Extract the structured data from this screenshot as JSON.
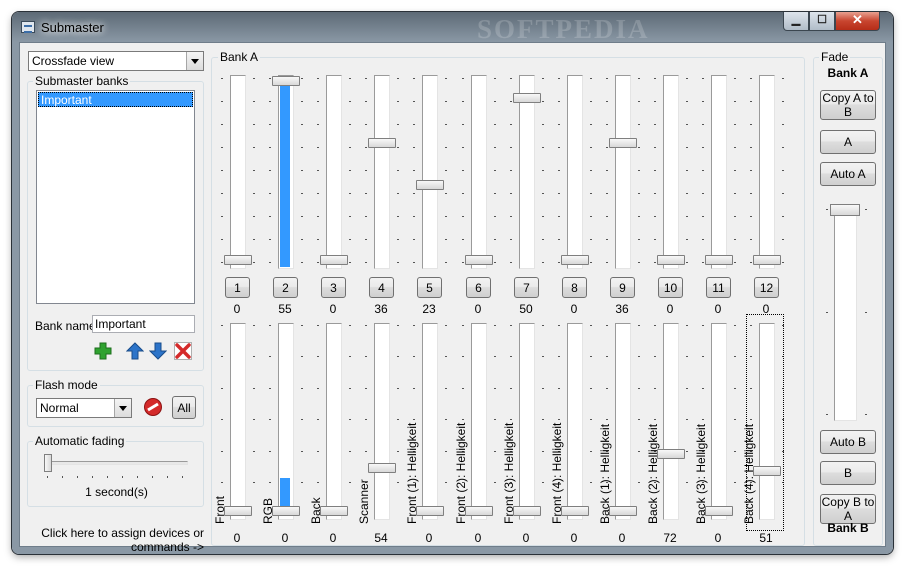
{
  "window": {
    "title": "Submaster",
    "watermark": "SOFTPEDIA",
    "min_glyph": "▁",
    "max_glyph": "☐",
    "close_glyph": "✕"
  },
  "left": {
    "view_combo": "Crossfade view",
    "banks_legend": "Submaster banks",
    "banks_list": [
      "Important"
    ],
    "bank_name_label": "Bank name:",
    "bank_name_value": "Important",
    "flash_legend": "Flash mode",
    "flash_combo": "Normal",
    "all_button": "All",
    "fading_legend": "Automatic fading",
    "fading_value": "1 second(s)",
    "fading_level": 0,
    "assign_text_line1": "Click here to assign devices or",
    "assign_text_line2": "commands ->"
  },
  "bank": {
    "legend": "Bank A",
    "top_row": [
      {
        "num": "1",
        "value": "0",
        "level": 0
      },
      {
        "num": "2",
        "value": "55",
        "level": 0.216
      },
      {
        "num": "3",
        "value": "0",
        "level": 0
      },
      {
        "num": "4",
        "value": "36",
        "level": 0.141
      },
      {
        "num": "5",
        "value": "23",
        "level": 0.09
      },
      {
        "num": "6",
        "value": "0",
        "level": 0
      },
      {
        "num": "7",
        "value": "50",
        "level": 0.196
      },
      {
        "num": "8",
        "value": "0",
        "level": 0
      },
      {
        "num": "9",
        "value": "36",
        "level": 0.141
      },
      {
        "num": "10",
        "value": "0",
        "level": 0
      },
      {
        "num": "11",
        "value": "0",
        "level": 0
      },
      {
        "num": "12",
        "value": "0",
        "level": 0
      }
    ],
    "bottom_row": [
      {
        "label": "Front",
        "value": "0",
        "level": 0,
        "fill": false
      },
      {
        "label": "RGB",
        "value": "0",
        "level": 0,
        "fill": true
      },
      {
        "label": "Back",
        "value": "0",
        "level": 0,
        "fill": false
      },
      {
        "label": "Scanner",
        "value": "54",
        "level": 0.212,
        "fill": false
      },
      {
        "label": "Front (1): Helligkeit",
        "value": "0",
        "level": 0,
        "fill": false
      },
      {
        "label": "Front (2): Helligkeit",
        "value": "0",
        "level": 0,
        "fill": false
      },
      {
        "label": "Front (3): Helligkeit",
        "value": "0",
        "level": 0,
        "fill": false
      },
      {
        "label": "Front (4): Helligkeit",
        "value": "0",
        "level": 0,
        "fill": false
      },
      {
        "label": "Back (1): Helligkeit",
        "value": "0",
        "level": 0,
        "fill": false
      },
      {
        "label": "Back (2): Helligkeit",
        "value": "72",
        "level": 0.282,
        "fill": false
      },
      {
        "label": "Back (3): Helligkeit",
        "value": "0",
        "level": 0,
        "fill": false
      },
      {
        "label": "Back (4): Helligkeit",
        "value": "51",
        "level": 0.2,
        "fill": false
      }
    ]
  },
  "fade": {
    "legend": "Fade",
    "bank_a": "Bank A",
    "copy_a_to_b": "Copy A to B",
    "a_button": "A",
    "auto_a": "Auto A",
    "auto_b": "Auto B",
    "b_button": "B",
    "copy_b_to_a": "Copy B to A",
    "bank_b": "Bank B",
    "crossfade_level": 1
  },
  "colors": {
    "accent": "#3399ff",
    "add": "#2fa22f",
    "move": "#2c74c9",
    "delete": "#d42a2a"
  }
}
